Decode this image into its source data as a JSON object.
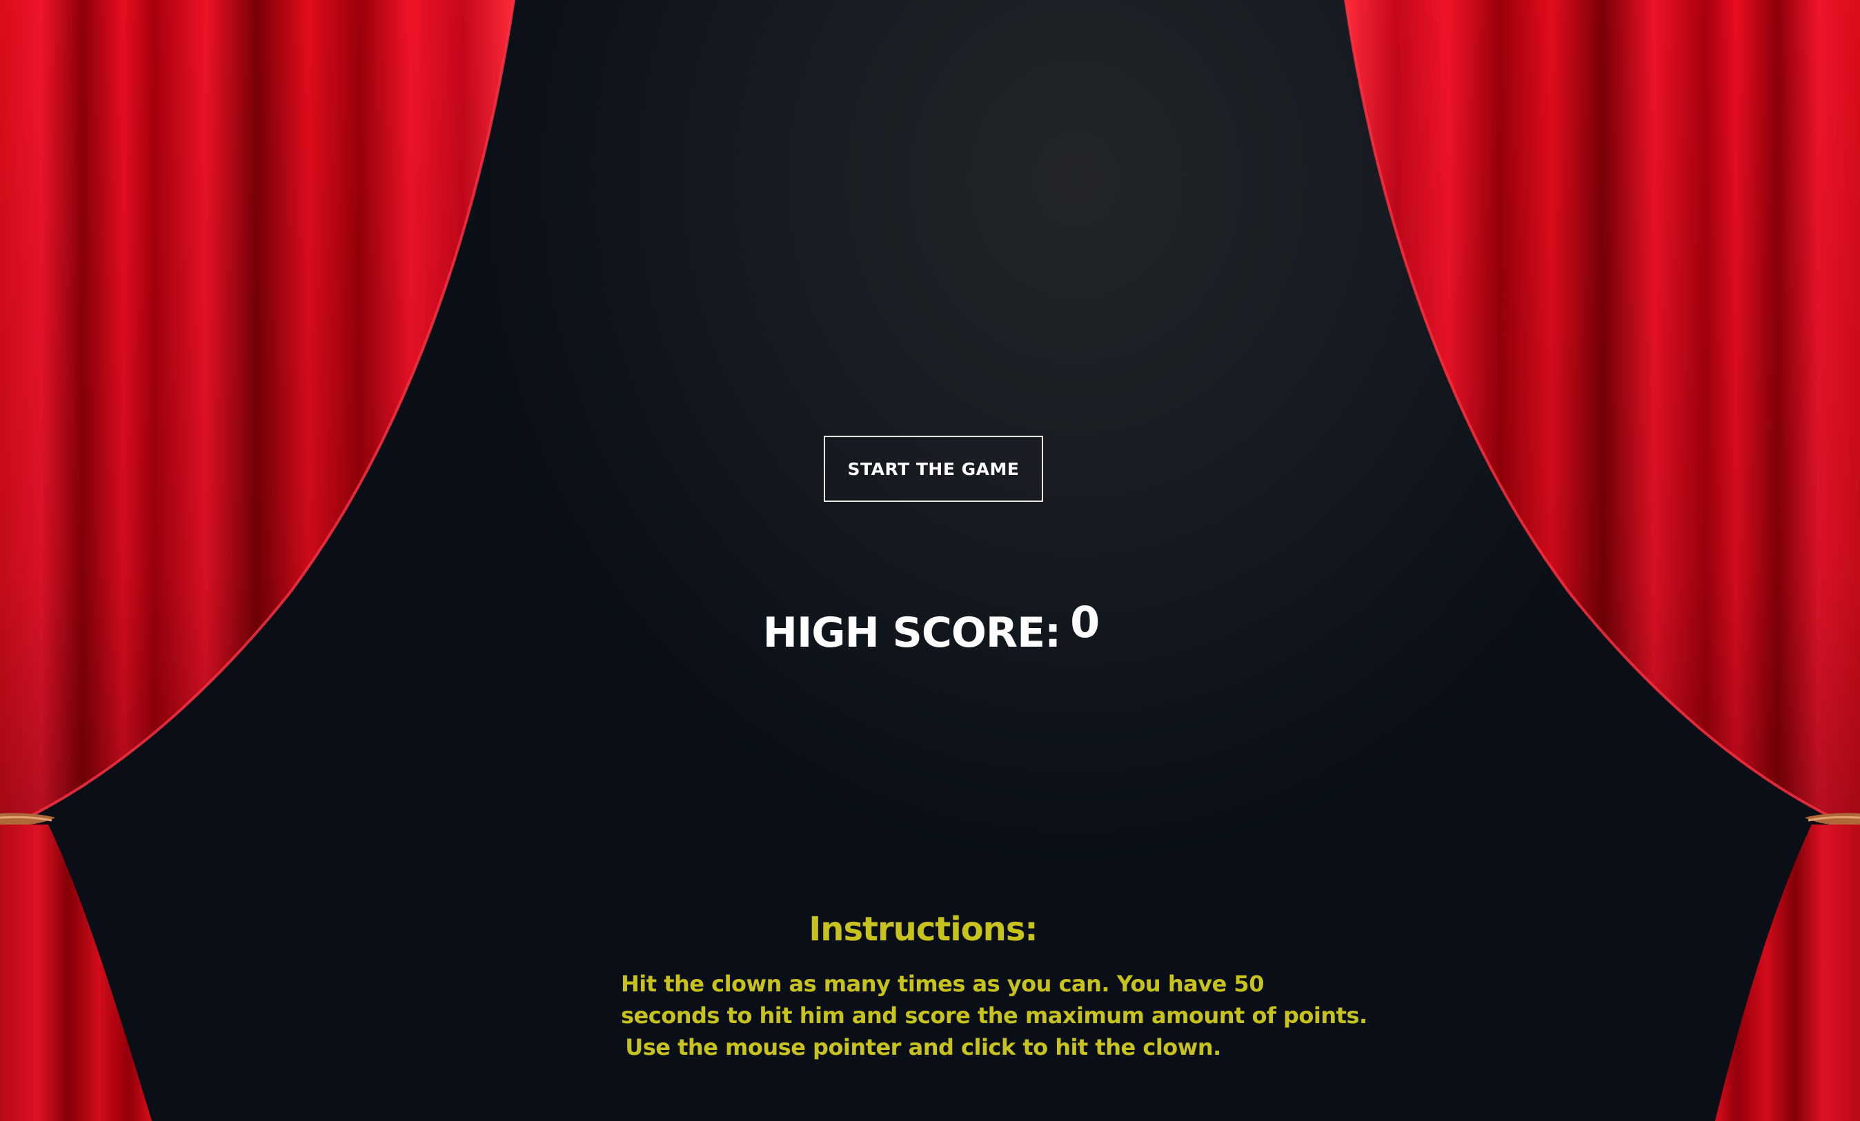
{
  "start_button": {
    "label": "START THE GAME"
  },
  "high_score": {
    "label": "HIGH SCORE:",
    "value": "0"
  },
  "instructions": {
    "title": "Instructions:",
    "lines": [
      "Hit the clown as many times as you can. You have 50",
      "seconds to hit him and score the maximum amount of points.",
      "Use the mouse pointer and click to hit the clown."
    ]
  },
  "colors": {
    "background": "#0a0f17",
    "curtain_red": "#e40e1d",
    "curtain_dark": "#8a0008",
    "instructions_text": "#c8c21c",
    "button_border": "#e8e8e8",
    "text_white": "#ffffff",
    "tieback": "#b0683a"
  },
  "icons": {
    "left_curtain": "left-curtain",
    "right_curtain": "right-curtain"
  }
}
